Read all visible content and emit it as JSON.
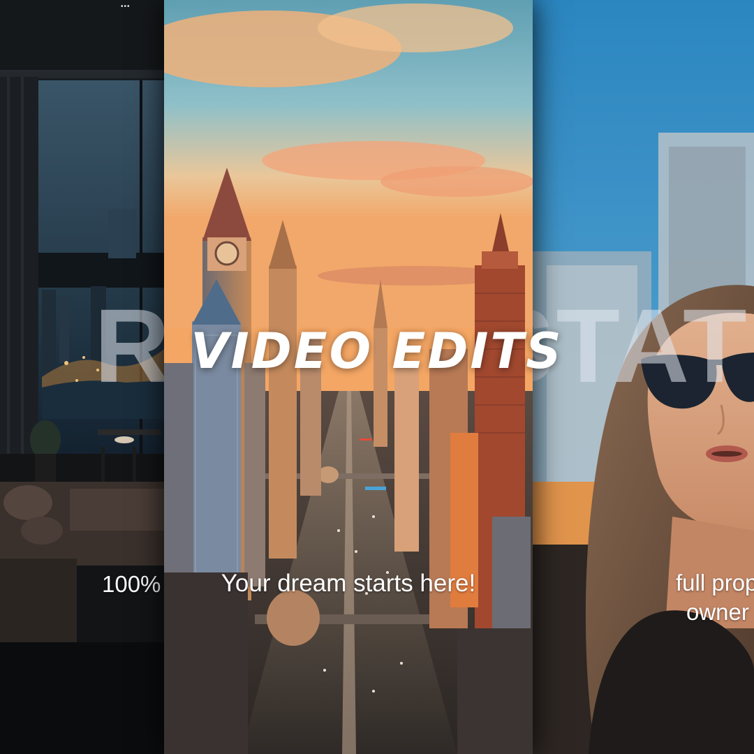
{
  "headline": "VIDEO EDITS",
  "background_word": "REAL ESTATE",
  "panels": {
    "left": {
      "caption": "100%"
    },
    "middle": {
      "caption": "Your dream starts here!"
    },
    "right": {
      "caption_line1": "full prop",
      "caption_line2": "owner"
    }
  },
  "top_dots": "•••",
  "colors": {
    "sky_top": "#6fa8b8",
    "sunset_orange": "#f0a45a",
    "night_blue": "#1c2a38",
    "sky_blue_right": "#2c8ec7"
  }
}
